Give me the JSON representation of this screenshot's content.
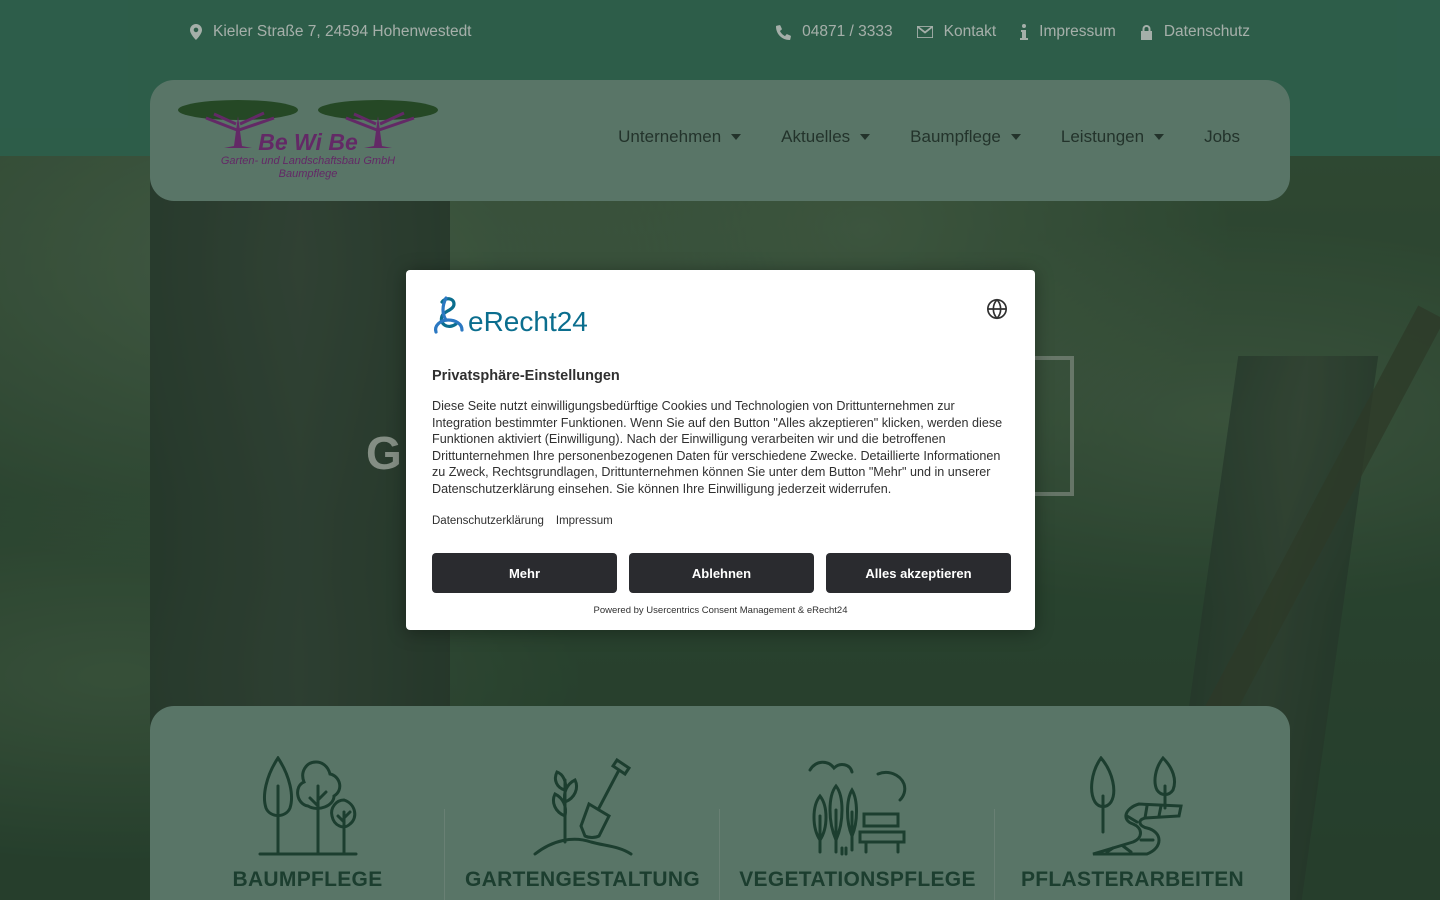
{
  "topbar": {
    "address": "Kieler Straße 7, 24594 Hohenwestedt",
    "phone": "04871 / 3333",
    "contact": "Kontakt",
    "imprint": "Impressum",
    "privacy": "Datenschutz",
    "icons": [
      "map-marker-icon",
      "phone-icon",
      "envelope-icon",
      "info-icon",
      "lock-icon"
    ]
  },
  "logo": {
    "name": "Be Wi Be",
    "line1": "Garten- und Landschaftsbau GmbH",
    "line2": "Baumpflege"
  },
  "nav": {
    "items": [
      {
        "label": "Unternehmen",
        "has_dropdown": true
      },
      {
        "label": "Aktuelles",
        "has_dropdown": true
      },
      {
        "label": "Baumpflege",
        "has_dropdown": true
      },
      {
        "label": "Leistungen",
        "has_dropdown": true
      },
      {
        "label": "Jobs",
        "has_dropdown": false
      }
    ]
  },
  "hero": {
    "partial_heading_letter": "G"
  },
  "services": [
    {
      "label": "BAUMPFLEGE",
      "icon": "trees-icon"
    },
    {
      "label": "GARTENGESTALTUNG",
      "icon": "plant-shovel-icon"
    },
    {
      "label": "VEGETATIONSPFLEGE",
      "icon": "park-bench-icon"
    },
    {
      "label": "PFLASTERARBEITEN",
      "icon": "paved-path-icon"
    }
  ],
  "consent": {
    "brand": "eRecht24",
    "title": "Privatsphäre-Einstellungen",
    "description": "Diese Seite nutzt einwilligungsbedürftige Cookies und Technologien von Drittunternehmen zur Integration bestimmter Funktionen. Wenn Sie auf den Button \"Alles akzeptieren\" klicken, werden diese Funktionen aktiviert (Einwilligung). Nach der Einwilligung verarbeiten wir und die betroffenen Drittunternehmen Ihre personenbezogenen Daten für verschiedene Zwecke. Detaillierte Informationen zu Zweck, Rechtsgrundlagen, Drittunternehmen können Sie unter dem Button \"Mehr\" und in unserer Datenschutzerklärung einsehen. Sie können Ihre Einwilligung jederzeit widerrufen.",
    "link_privacy": "Datenschutzerklärung",
    "link_imprint": "Impressum",
    "btn_more": "Mehr",
    "btn_deny": "Ablehnen",
    "btn_accept": "Alles akzeptieren",
    "powered": "Powered by Usercentrics Consent Management & eRecht24"
  },
  "colors": {
    "topbar": "#3b7a62",
    "card": "#7f9e90",
    "service_text": "#214a3a",
    "button": "#2a2b2f",
    "brand_blue": "#0b6e8e",
    "logo_purple": "#8e2a8e"
  }
}
